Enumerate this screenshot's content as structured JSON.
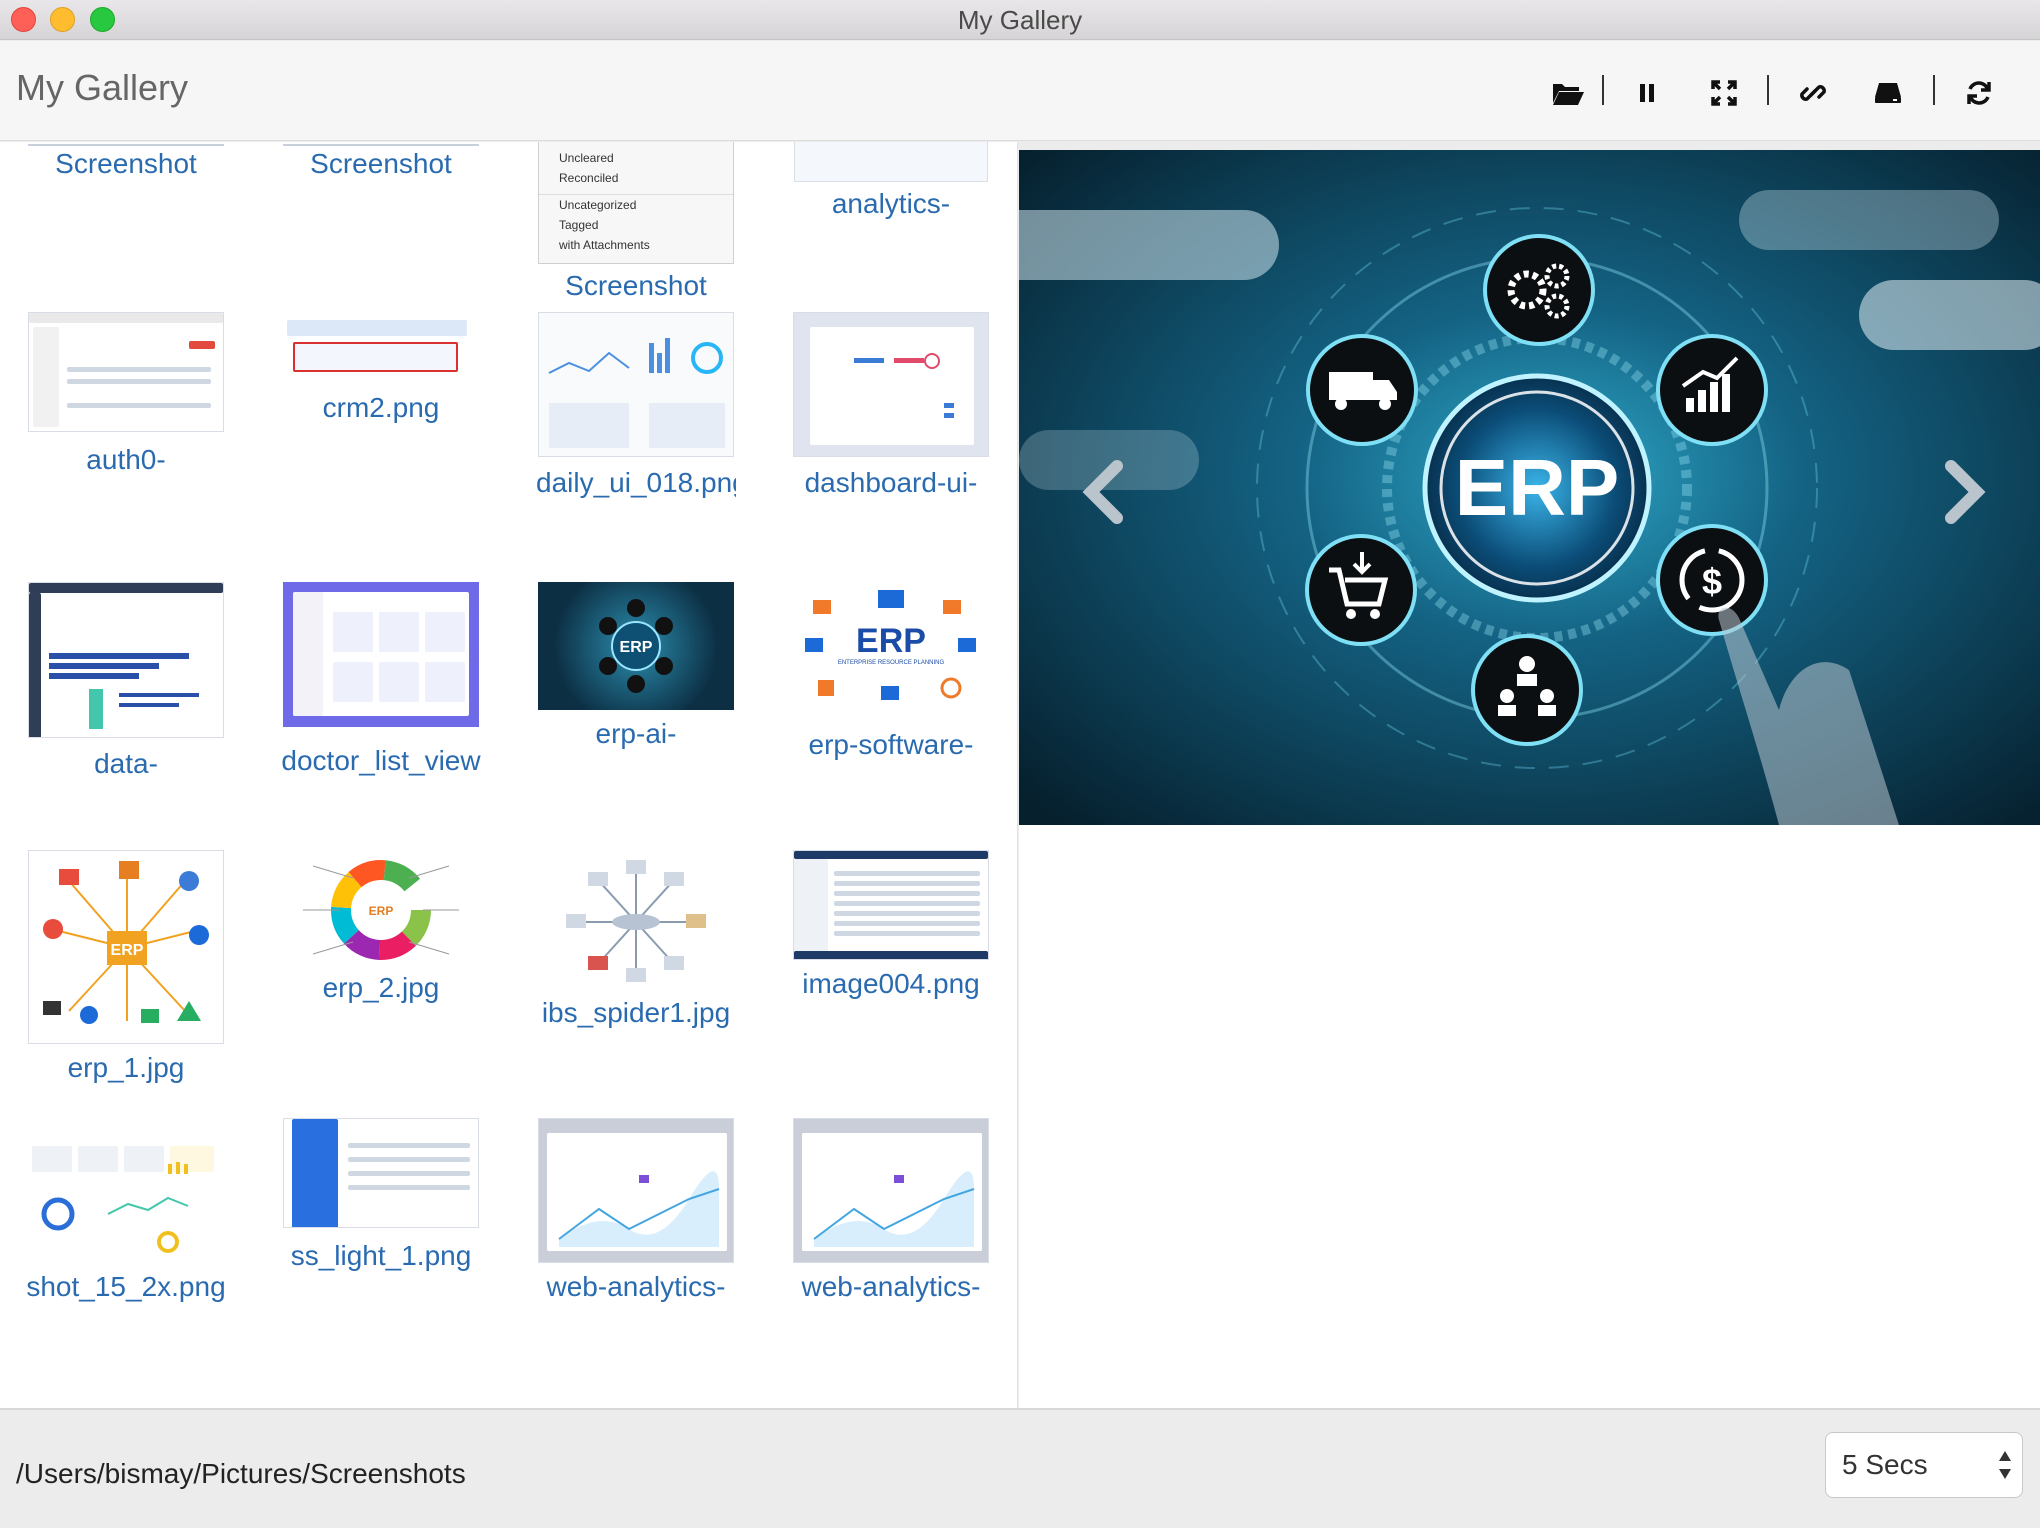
{
  "window": {
    "title": "My Gallery"
  },
  "header": {
    "title": "My Gallery"
  },
  "toolbar": {
    "buttons": [
      "folder-open-icon",
      "pause-icon",
      "fullscreen-icon",
      "link-icon",
      "drive-icon",
      "refresh-icon"
    ]
  },
  "gallery": {
    "partial_row": [
      {
        "name": "Screenshot"
      },
      {
        "name": "Screenshot"
      },
      {
        "name": "Screenshot",
        "menu": [
          "Uncleared",
          "Reconciled",
          "Uncategorized",
          "Tagged",
          "with Attachments"
        ]
      },
      {
        "name": "analytics-"
      }
    ],
    "items": [
      {
        "name": "auth0-"
      },
      {
        "name": "crm2.png"
      },
      {
        "name": "daily_ui_018.png"
      },
      {
        "name": "dashboard-ui-"
      },
      {
        "name": "data-"
      },
      {
        "name": "doctor_list_view"
      },
      {
        "name": "erp-ai-",
        "thumb_text": "ERP"
      },
      {
        "name": "erp-software-",
        "thumb_text": "ERP",
        "thumb_sub": "ENTERPRISE RESOURCE PLANNING"
      },
      {
        "name": "erp_1.jpg",
        "thumb_text": "ERP"
      },
      {
        "name": "erp_2.jpg",
        "thumb_text": "ERP"
      },
      {
        "name": "ibs_spider1.jpg"
      },
      {
        "name": "image004.png"
      },
      {
        "name": "shot_15_2x.png"
      },
      {
        "name": "ss_light_1.png"
      },
      {
        "name": "web-analytics-"
      },
      {
        "name": "web-analytics-"
      }
    ]
  },
  "preview": {
    "center_text": "ERP"
  },
  "footer": {
    "path": "/Users/bismay/Pictures/Screenshots",
    "interval": "5 Secs"
  },
  "colors": {
    "link": "#2a6bb0",
    "preview_bg": "#0a2a3c",
    "accent": "#29c3e6"
  }
}
